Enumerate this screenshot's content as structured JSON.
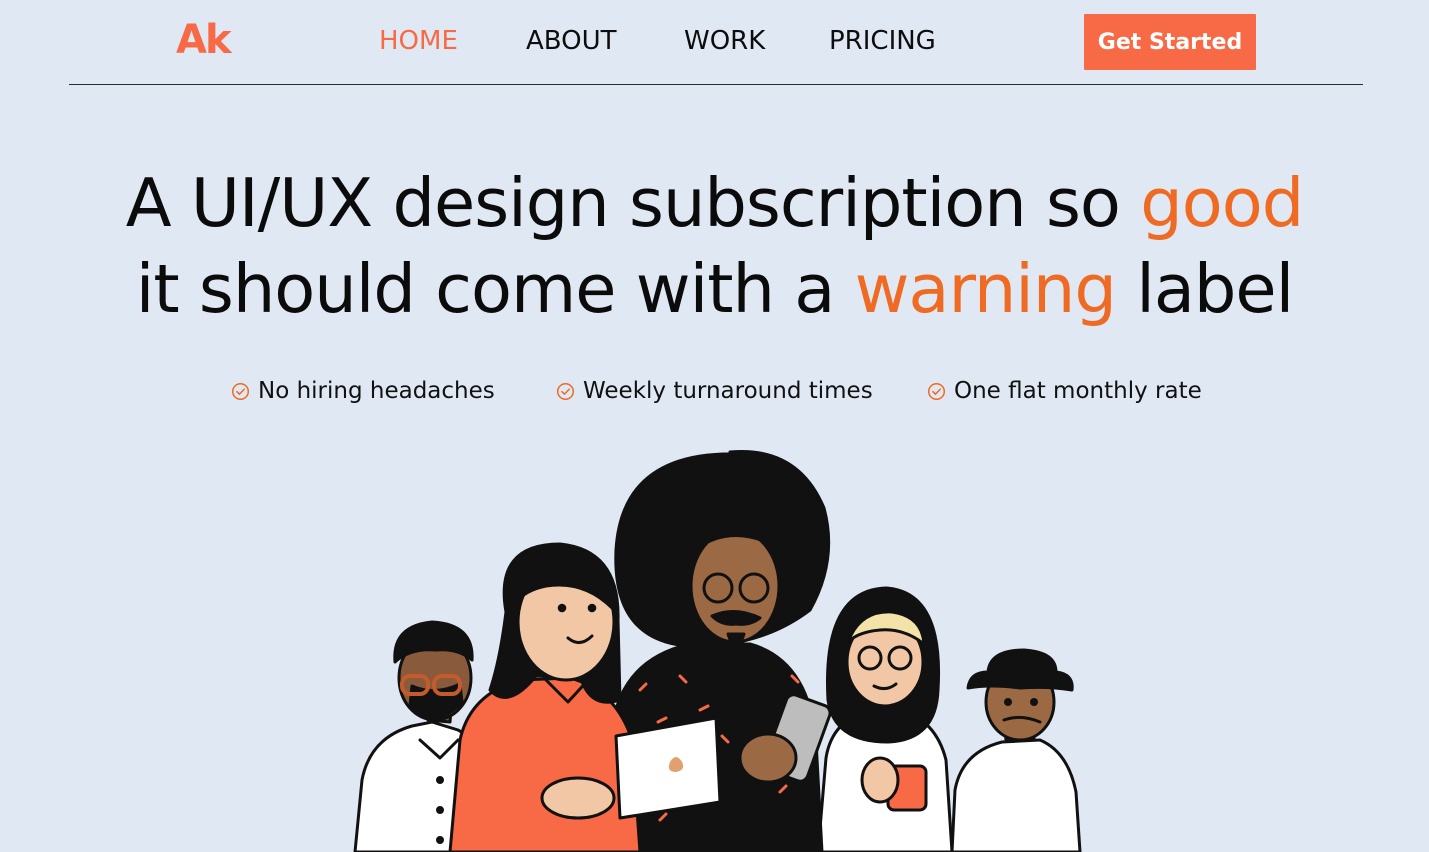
{
  "brand": {
    "logo": "Ak"
  },
  "nav": {
    "items": [
      {
        "label": "HOME",
        "active": true
      },
      {
        "label": "ABOUT",
        "active": false
      },
      {
        "label": "WORK",
        "active": false
      },
      {
        "label": "PRICING",
        "active": false
      }
    ],
    "cta_label": "Get Started"
  },
  "hero": {
    "line1_part1": "A UI/UX design subscription so ",
    "line1_highlight": "good",
    "line2_part1": "it should come with a ",
    "line2_highlight": "warning",
    "line2_part2": " label"
  },
  "features": [
    {
      "label": "No hiring headaches",
      "icon": "check-circle-icon"
    },
    {
      "label": "Weekly turnaround times",
      "icon": "check-circle-icon"
    },
    {
      "label": "One flat monthly rate",
      "icon": "check-circle-icon"
    }
  ],
  "colors": {
    "background": "#e0e9f3",
    "accent": "#f76a45",
    "highlight": "#ef6a22",
    "text": "#0b0b0b"
  }
}
